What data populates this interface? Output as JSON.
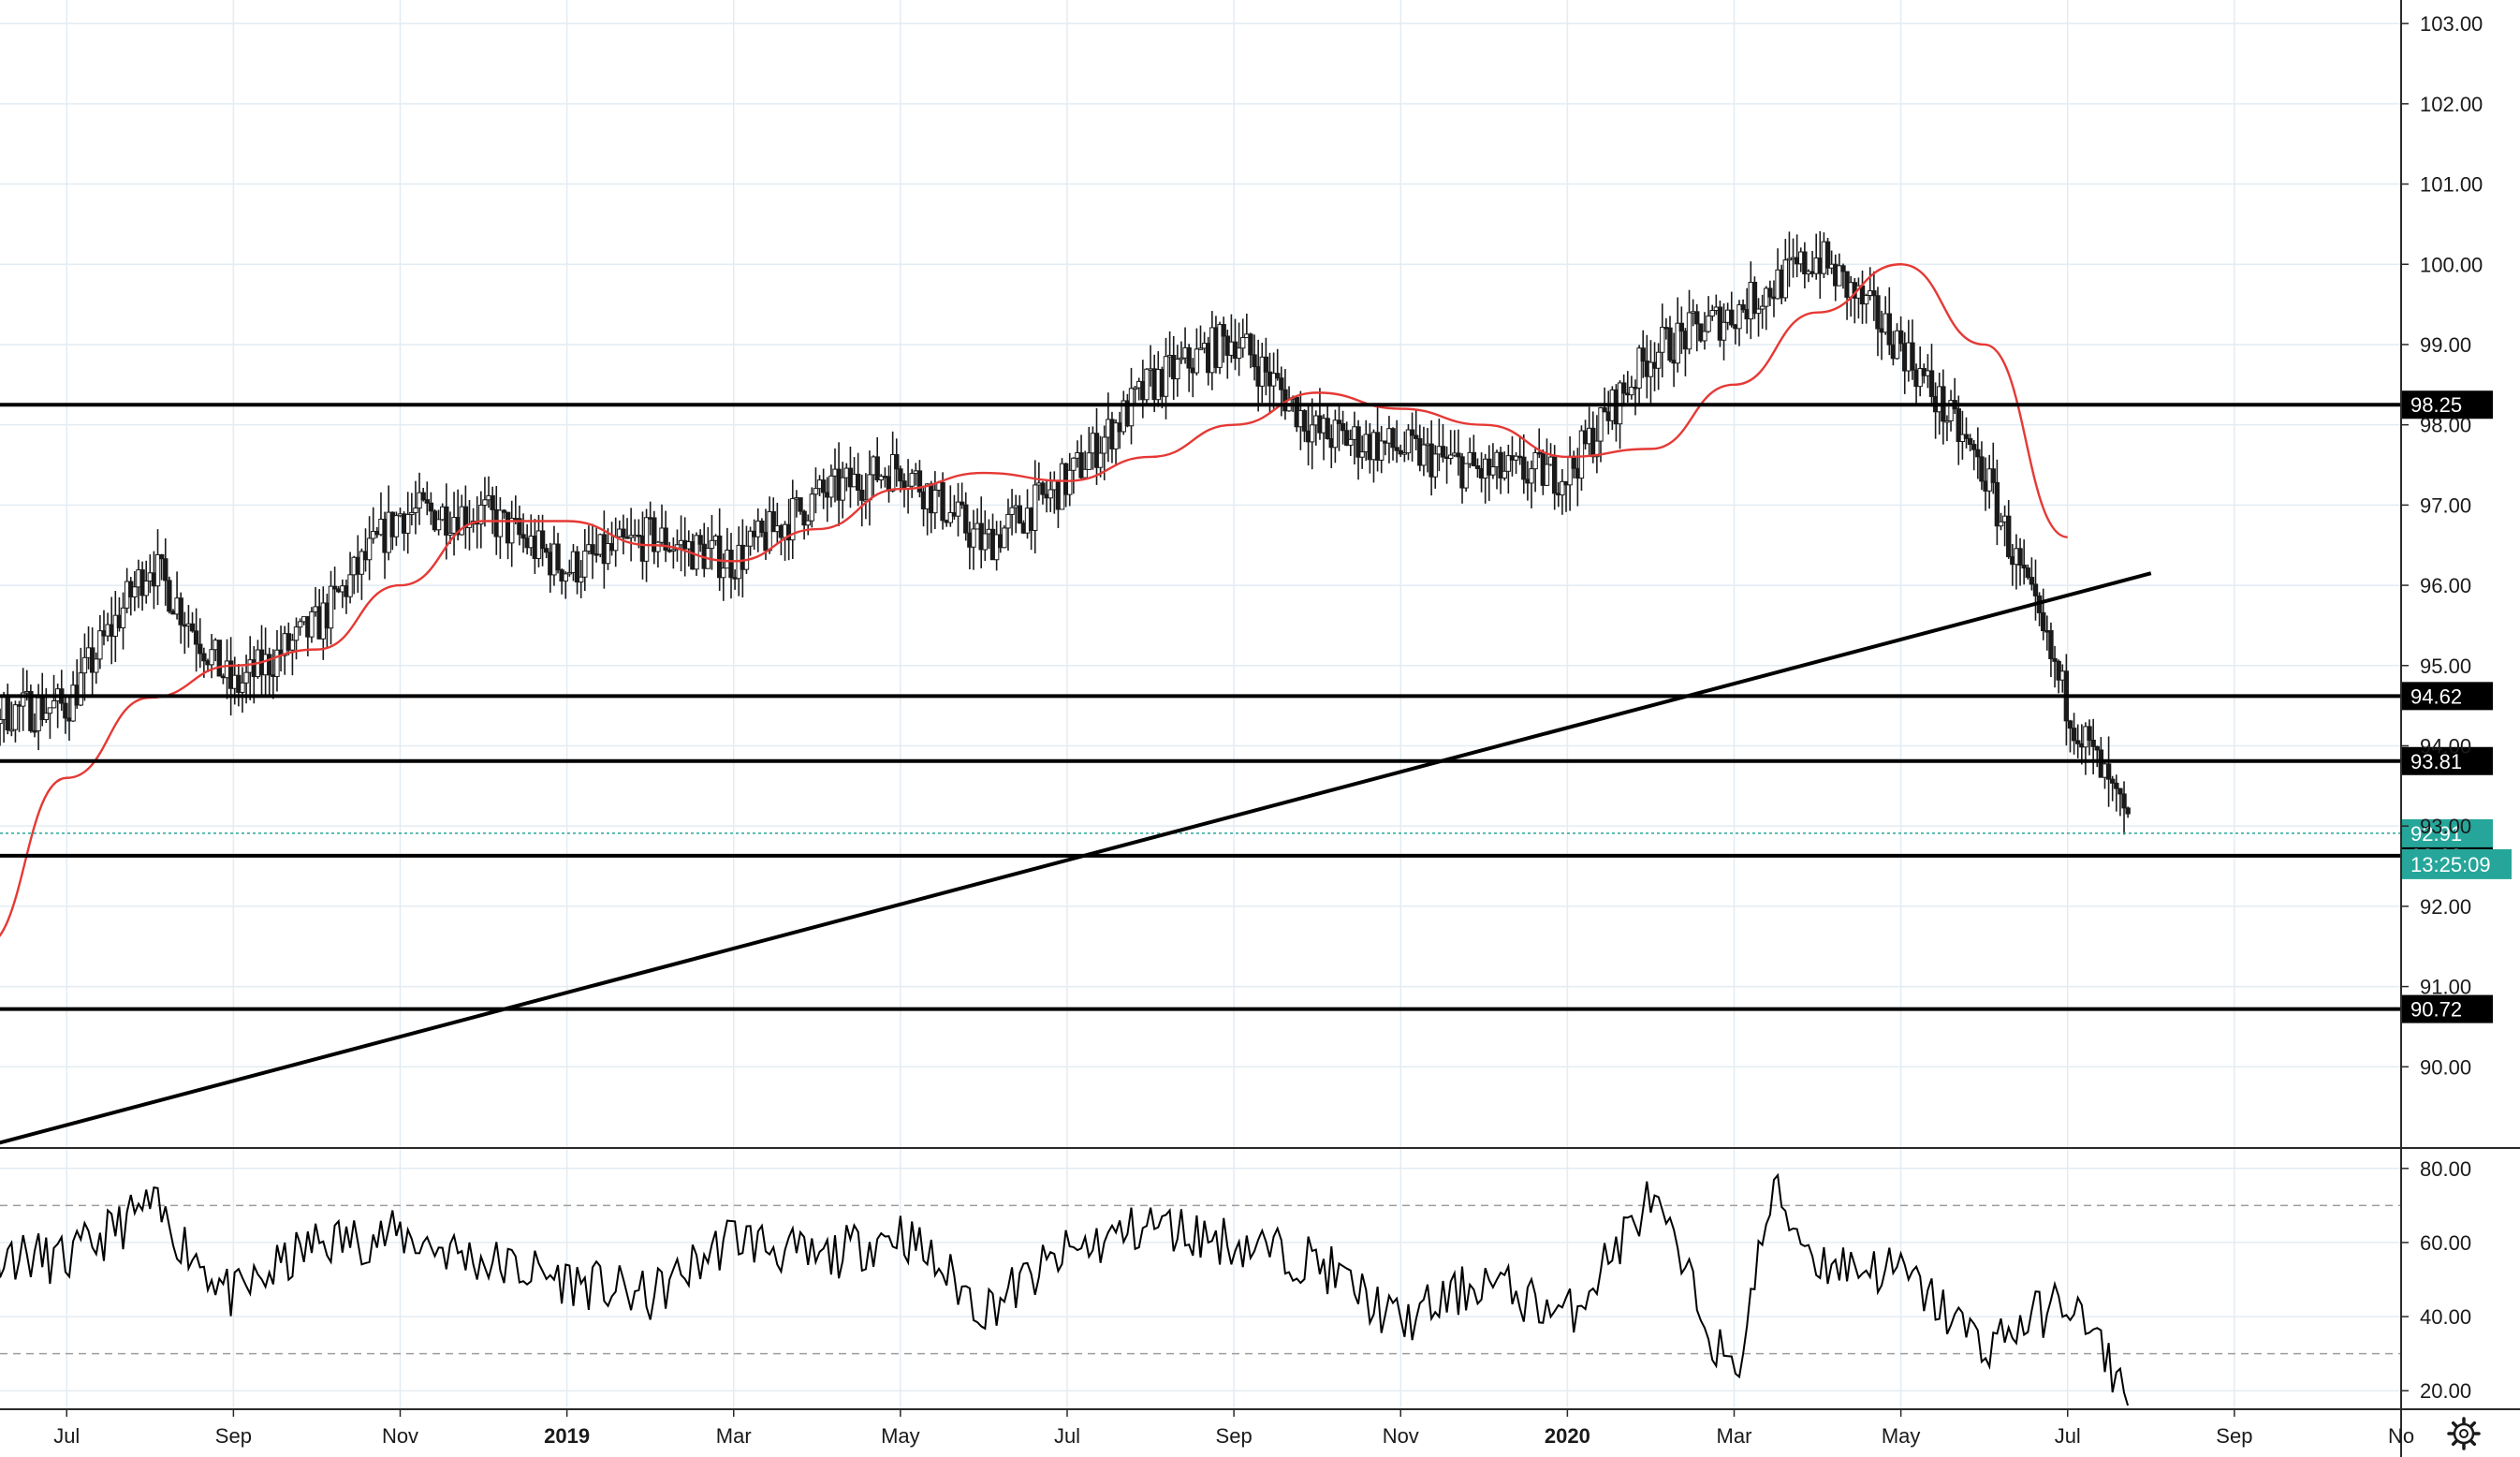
{
  "colors": {
    "candle": "#1a1a1a",
    "candle_up_body": "#ffffff",
    "ma_line": "#e53935",
    "hline": "#000000",
    "trendline": "#000000",
    "rsi_line": "#000000",
    "current_price": "#26a69a",
    "grid": "#e3ecf3"
  },
  "icons": {
    "settings": "gear-icon"
  },
  "chart_data": [
    {
      "type": "candlestick",
      "ylim": [
        89.0,
        103.2
      ],
      "y_ticks": [
        "90.00",
        "91.00",
        "92.00",
        "93.00",
        "94.00",
        "95.00",
        "96.00",
        "97.00",
        "98.00",
        "99.00",
        "100.00",
        "101.00",
        "102.00",
        "103.00"
      ],
      "x_ticks": [
        "Jul",
        "Sep",
        "Nov",
        "2019",
        "Mar",
        "May",
        "Jul",
        "Sep",
        "Nov",
        "2020",
        "Mar",
        "May",
        "Jul",
        "Sep",
        "No"
      ],
      "x_ticks_bold": [
        "2019",
        "2020"
      ],
      "horizontal_levels": [
        {
          "value": 98.25,
          "label": "98.25"
        },
        {
          "value": 94.62,
          "label": "94.62"
        },
        {
          "value": 93.81,
          "label": "93.81"
        },
        {
          "value": 92.63,
          "label": "92.63"
        },
        {
          "value": 90.72,
          "label": "90.72"
        }
      ],
      "current_price": {
        "value": 92.91,
        "label": "92.91",
        "countdown": "13:25:09"
      },
      "trendline": {
        "start": {
          "date": "2018-06",
          "value": 89.0
        },
        "end": {
          "date": "2020-08",
          "value": 96.15
        }
      },
      "series": [
        {
          "kind": "ohlc",
          "dates": [
            "2018-05",
            "2018-06",
            "2018-07",
            "2018-08",
            "2018-09",
            "2018-10",
            "2018-11",
            "2018-12",
            "2019-01",
            "2019-02",
            "2019-03",
            "2019-04",
            "2019-05",
            "2019-06",
            "2019-07",
            "2019-08",
            "2019-09",
            "2019-10",
            "2019-11",
            "2019-12",
            "2020-01",
            "2020-02",
            "2020-03",
            "2020-04",
            "2020-05",
            "2020-06",
            "2020-07",
            "2020-07-24"
          ],
          "close": [
            92.8,
            94.4,
            94.5,
            96.3,
            94.7,
            95.5,
            96.9,
            96.9,
            96.2,
            96.6,
            96.3,
            97.1,
            97.5,
            96.5,
            97.3,
            98.5,
            99.1,
            97.9,
            97.7,
            97.4,
            97.4,
            98.9,
            99.4,
            100.1,
            99.0,
            97.4,
            94.5,
            92.91
          ]
        },
        {
          "kind": "moving_average",
          "dates": [
            "2018-05",
            "2018-06",
            "2018-07",
            "2018-08",
            "2018-09",
            "2018-10",
            "2018-11",
            "2018-12",
            "2019-01",
            "2019-02",
            "2019-03",
            "2019-04",
            "2019-05",
            "2019-06",
            "2019-07",
            "2019-08",
            "2019-09",
            "2019-10",
            "2019-11",
            "2019-12",
            "2020-01",
            "2020-02",
            "2020-03",
            "2020-04",
            "2020-05",
            "2020-06",
            "2020-07"
          ],
          "values": [
            89.5,
            91.5,
            93.6,
            94.6,
            95.0,
            95.2,
            96.0,
            96.8,
            96.8,
            96.5,
            96.3,
            96.7,
            97.2,
            97.4,
            97.3,
            97.6,
            98.0,
            98.4,
            98.2,
            98.0,
            97.6,
            97.7,
            98.5,
            99.4,
            100.0,
            99.0,
            96.6
          ]
        }
      ]
    },
    {
      "type": "line",
      "ylim": [
        15,
        85
      ],
      "y_ticks": [
        "20.00",
        "40.00",
        "60.00",
        "80.00"
      ],
      "reference_levels": [
        30,
        70
      ],
      "series": [
        {
          "dates": [
            "2018-05",
            "2018-06",
            "2018-07",
            "2018-08",
            "2018-09",
            "2018-10",
            "2018-11",
            "2018-12",
            "2019-01",
            "2019-02",
            "2019-03",
            "2019-04",
            "2019-05",
            "2019-06",
            "2019-07",
            "2019-08",
            "2019-09",
            "2019-10",
            "2019-11",
            "2019-12",
            "2020-01",
            "2020-02",
            "2020-03",
            "2020-03-15",
            "2020-04",
            "2020-05",
            "2020-06",
            "2020-07",
            "2020-07-24"
          ],
          "values": [
            72,
            58,
            55,
            70,
            45,
            60,
            62,
            55,
            50,
            45,
            62,
            55,
            63,
            42,
            57,
            65,
            60,
            55,
            38,
            50,
            40,
            72,
            22,
            74,
            55,
            52,
            32,
            45,
            18
          ]
        }
      ]
    }
  ]
}
